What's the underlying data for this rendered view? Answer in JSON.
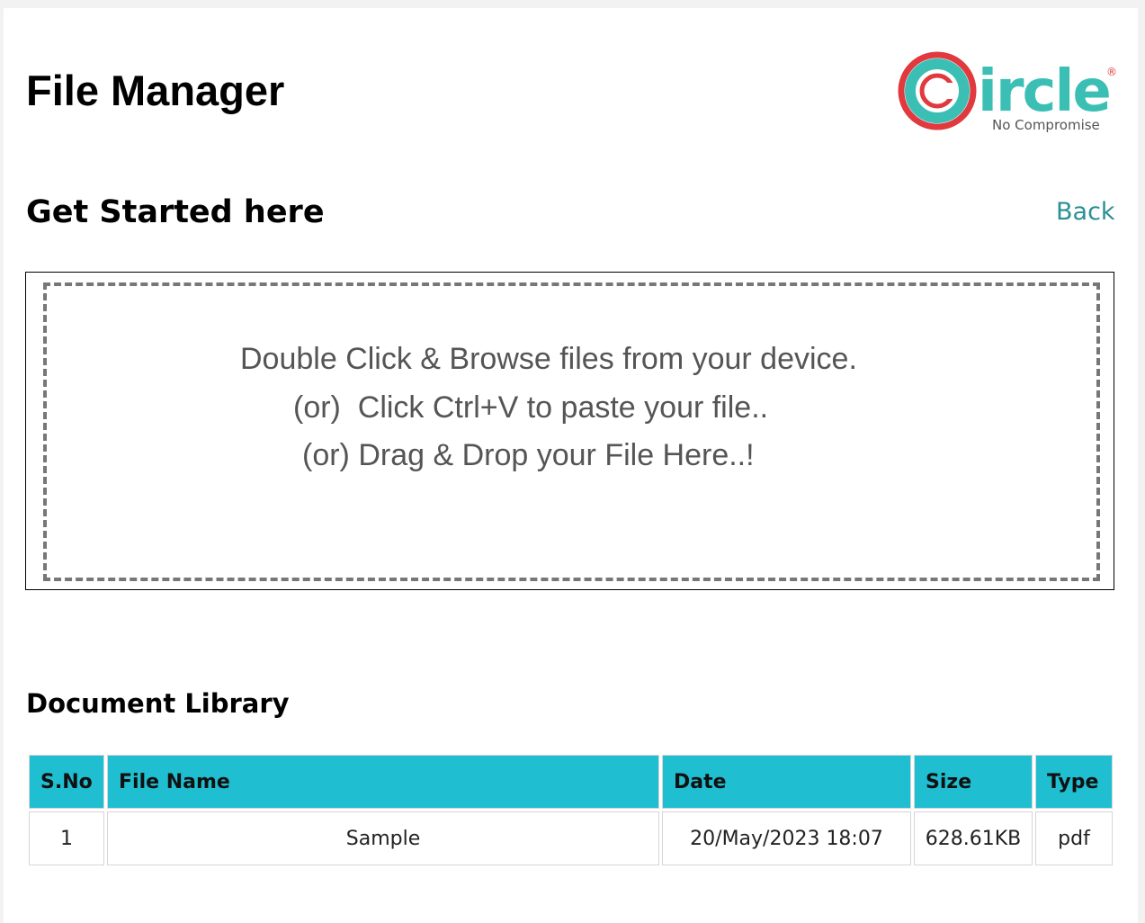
{
  "header": {
    "title": "File Manager",
    "logo": {
      "wordmark": "ircle",
      "letter": "C",
      "registered": "®",
      "tagline": "No Compromise",
      "colors": {
        "teal": "#3bbfb5",
        "red": "#e0393e"
      }
    }
  },
  "upload": {
    "heading": "Get Started here",
    "back_label": "Back",
    "lines": [
      "Double Click & Browse files from your device.",
      "(or)  Click Ctrl+V to paste your file..",
      "(or) Drag & Drop your File Here..!"
    ]
  },
  "library": {
    "heading": "Document Library",
    "columns": [
      "S.No",
      "File Name",
      "Date",
      "Size",
      "Type"
    ],
    "rows": [
      [
        "1",
        "Sample",
        "20/May/2023 18:07",
        "628.61KB",
        "pdf"
      ]
    ],
    "header_color": "#1fbfd1"
  },
  "colors": {
    "link": "#2c8f95",
    "dropzone_text": "#555555"
  }
}
